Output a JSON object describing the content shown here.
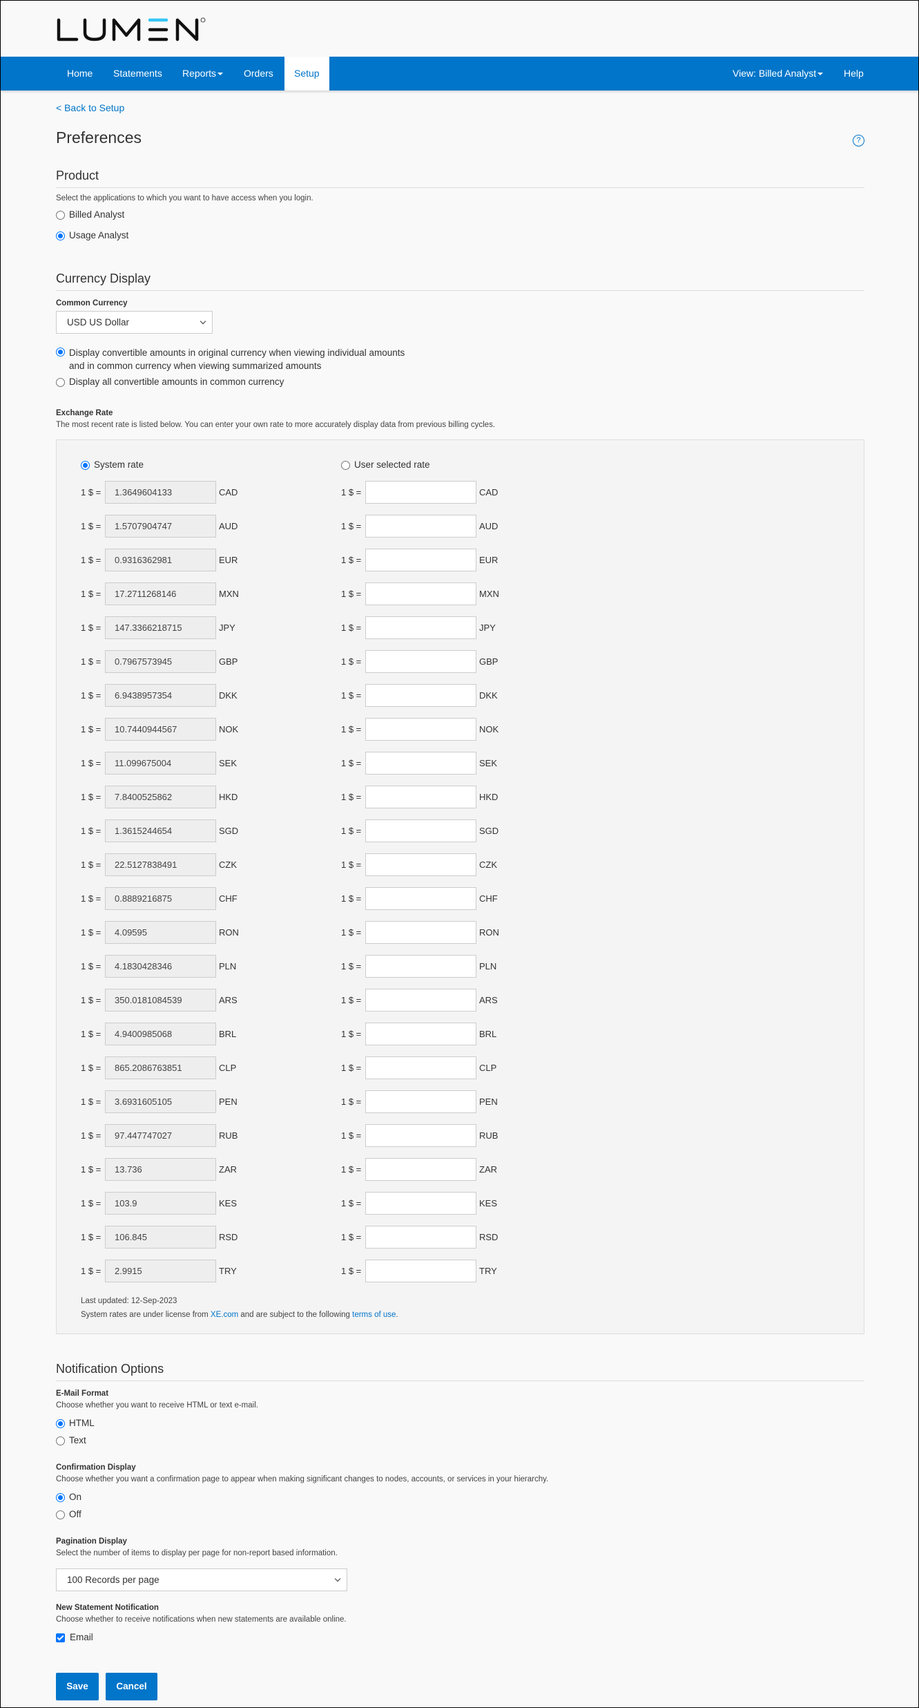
{
  "header": {
    "logo_text": "LUMEN",
    "nav": [
      {
        "label": "Home"
      },
      {
        "label": "Statements"
      },
      {
        "label": "Reports"
      },
      {
        "label": "Orders"
      },
      {
        "label": "Setup"
      }
    ],
    "view_label": "View: Billed Analyst",
    "help_label": "Help"
  },
  "page": {
    "back_link": "< Back to Setup",
    "title": "Preferences",
    "help_icon": "?"
  },
  "product": {
    "title": "Product",
    "description": "Select the applications to which you want to have access when you login.",
    "options": [
      {
        "label": "Billed Analyst",
        "selected": false
      },
      {
        "label": "Usage Analyst",
        "selected": true
      }
    ]
  },
  "currency": {
    "title": "Currency Display",
    "common_currency_label": "Common Currency",
    "common_currency_value": "USD US Dollar",
    "display_options": [
      {
        "label_line1": "Display convertible amounts in original currency when viewing individual amounts",
        "label_line2": "and in common currency when viewing summarized amounts",
        "selected": true
      },
      {
        "label_line1": "Display all convertible amounts in common currency",
        "label_line2": "",
        "selected": false
      }
    ],
    "exchange_rate_label": "Exchange Rate",
    "exchange_rate_description": "The most recent rate is listed below. You can enter your own rate to more accurately display data from previous billing cycles.",
    "system_rate_label": "System rate",
    "user_rate_label": "User selected rate",
    "rate_prefix": "1 $ =",
    "rates": [
      {
        "code": "CAD",
        "system": "1.3649604133",
        "user": ""
      },
      {
        "code": "AUD",
        "system": "1.5707904747",
        "user": ""
      },
      {
        "code": "EUR",
        "system": "0.9316362981",
        "user": ""
      },
      {
        "code": "MXN",
        "system": "17.2711268146",
        "user": ""
      },
      {
        "code": "JPY",
        "system": "147.3366218715",
        "user": ""
      },
      {
        "code": "GBP",
        "system": "0.7967573945",
        "user": ""
      },
      {
        "code": "DKK",
        "system": "6.9438957354",
        "user": ""
      },
      {
        "code": "NOK",
        "system": "10.7440944567",
        "user": ""
      },
      {
        "code": "SEK",
        "system": "11.099675004",
        "user": ""
      },
      {
        "code": "HKD",
        "system": "7.8400525862",
        "user": ""
      },
      {
        "code": "SGD",
        "system": "1.3615244654",
        "user": ""
      },
      {
        "code": "CZK",
        "system": "22.5127838491",
        "user": ""
      },
      {
        "code": "CHF",
        "system": "0.8889216875",
        "user": ""
      },
      {
        "code": "RON",
        "system": "4.09595",
        "user": ""
      },
      {
        "code": "PLN",
        "system": "4.1830428346",
        "user": ""
      },
      {
        "code": "ARS",
        "system": "350.0181084539",
        "user": ""
      },
      {
        "code": "BRL",
        "system": "4.9400985068",
        "user": ""
      },
      {
        "code": "CLP",
        "system": "865.2086763851",
        "user": ""
      },
      {
        "code": "PEN",
        "system": "3.6931605105",
        "user": ""
      },
      {
        "code": "RUB",
        "system": "97.447747027",
        "user": ""
      },
      {
        "code": "ZAR",
        "system": "13.736",
        "user": ""
      },
      {
        "code": "KES",
        "system": "103.9",
        "user": ""
      },
      {
        "code": "RSD",
        "system": "106.845",
        "user": ""
      },
      {
        "code": "TRY",
        "system": "2.9915",
        "user": ""
      }
    ],
    "last_updated": "Last updated: 12-Sep-2023",
    "license_prefix": "System rates are under license from ",
    "license_link": "XE.com",
    "license_middle": " and are subject to the following ",
    "terms_link": "terms of use",
    "license_suffix": "."
  },
  "notifications": {
    "title": "Notification Options",
    "email_format": {
      "label": "E-Mail Format",
      "description": "Choose whether you want to receive HTML or text e-mail.",
      "options": [
        {
          "label": "HTML",
          "selected": true
        },
        {
          "label": "Text",
          "selected": false
        }
      ]
    },
    "confirmation": {
      "label": "Confirmation Display",
      "description": "Choose whether you want a confirmation page to appear when making significant changes to nodes, accounts, or services in your hierarchy.",
      "options": [
        {
          "label": "On",
          "selected": true
        },
        {
          "label": "Off",
          "selected": false
        }
      ]
    },
    "pagination": {
      "label": "Pagination Display",
      "description": "Select the number of items to display per page for non-report based information.",
      "value": "100 Records per page"
    },
    "new_statement": {
      "label": "New Statement Notification",
      "description": "Choose whether to receive notifications when new statements are available online.",
      "email_label": "Email",
      "email_checked": true
    }
  },
  "actions": {
    "save_label": "Save",
    "cancel_label": "Cancel"
  },
  "colors": {
    "brand_blue": "#0075c9",
    "logo_accent": "#38c6f4"
  }
}
